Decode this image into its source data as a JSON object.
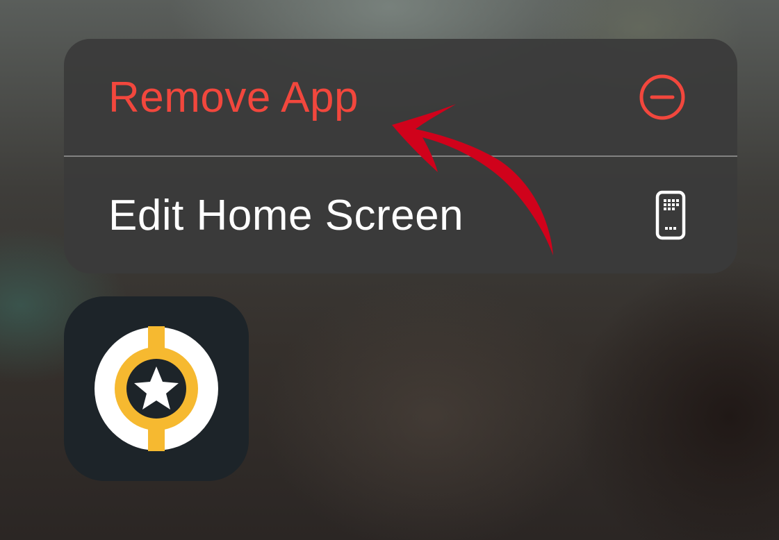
{
  "context_menu": {
    "items": [
      {
        "label": "Remove App",
        "icon": "minus-circle-icon",
        "color": "#f2473d"
      },
      {
        "label": "Edit Home Screen",
        "icon": "phone-home-screen-icon",
        "color": "#ffffff"
      }
    ]
  },
  "app": {
    "icon": "star-badge-app-icon",
    "colors": [
      "#1d2429",
      "#ffffff",
      "#f6b930"
    ]
  },
  "annotation": {
    "icon": "red-curved-arrow",
    "color": "#d0021b"
  }
}
